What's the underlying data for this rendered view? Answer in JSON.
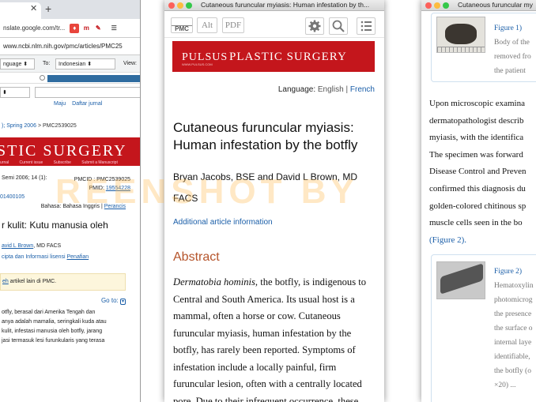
{
  "left_window": {
    "new_tab": "+",
    "translate_url": "nslate.google.com/tr...",
    "pmc_url": "www.ncbi.nlm.nih.gov/pmc/articles/PMC25",
    "from_lang": "nguage",
    "to_label": "To:",
    "to_lang": "Indonesian",
    "view_label": "View:",
    "links": [
      "Maju",
      "Daftar jurnal"
    ],
    "breadcrumb_1": "); Spring 2006",
    "breadcrumb_2": "PMC2539025",
    "banner_title": "STIC SURGERY",
    "banner_nav": [
      "urnal",
      "Current issue",
      "Subscribe",
      "Submit a Manuscript"
    ],
    "issue": "Semi 2006; 14 (1):",
    "pmcid": "PMCID : PMC2539025",
    "pmid_label": "PMID:",
    "pmid": "19554228",
    "doi": "01400105",
    "lang_label": "Bahasa: Bahasa",
    "lang_en": "Inggris",
    "lang_fr": "Perancis",
    "title": "r kulit: Kutu manusia oleh",
    "author_link": "avid L Brown",
    "author_suffix": ", MD FACS",
    "copyright": "cipta dan Informasi lisensi",
    "disclaimer": "Penafian",
    "notice_link": "eh",
    "notice_text": "artikel lain di PMC.",
    "goto": "Go to:",
    "abstract_lines": [
      "otfly, berasal dari Amerika Tengah dan",
      "anya adalah mamalia, seringkali kuda atau",
      "kulit, infestasi manusia oleh botfly, jarang",
      "jasi termasuk lesi furunkularis yang terasa"
    ]
  },
  "middle_window": {
    "window_title": "Cutaneous furuncular myiasis: Human infestation by th...",
    "toolbar": {
      "pmc": "PMC",
      "alt": "Alt",
      "pdf": "PDF"
    },
    "logo_pulsus": "PULSUS",
    "logo_pulsus_small": "WWW.PULSUS.COM",
    "logo_title": "PLASTIC SURGERY",
    "language_label": "Language:",
    "language_english": "English",
    "language_sep": "|",
    "language_french": "French",
    "article_title": "Cutaneous furuncular myiasis: Human infestation by the botfly",
    "authors": "Bryan Jacobs, BSE and David L Brown, MD FACS",
    "additional_info": "Additional article information",
    "abstract_heading": "Abstract",
    "abstract_species": "Dermatobia hominis",
    "abstract_text": ", the botfly, is indigenous to Central and South America. Its usual host is a mammal, often a horse or cow. Cutaneous furuncular myiasis, human infestation by the botfly, has rarely been reported. Symptoms of infestation include a locally painful, firm furuncular lesion, often with a centrally located pore. Due to their infrequent occurrence, these"
  },
  "right_window": {
    "window_title": "Cutaneous furuncular my",
    "figure1_link": "Figure 1)",
    "figure1_caption": [
      "Body of the",
      "removed fro",
      "the patient"
    ],
    "body_lines": [
      "Upon microscopic examina",
      "dermatopathologist describ",
      "myiasis, with the identifica",
      "The specimen was forward",
      "Disease Control and Preven",
      "confirmed this diagnosis du",
      "golden-colored chitinous sp",
      "muscle cells seen in the bo"
    ],
    "figure2_ref": "(Figure 2).",
    "figure2_link": "Figure 2)",
    "figure2_caption": [
      "Hematoxylin",
      "photomicrog",
      "the presence",
      "the surface o",
      "internal laye",
      "identifiable,",
      "the botfly (o",
      "×20) ..."
    ]
  },
  "watermark": "REENSHOT BY",
  "colors": {
    "pmc_red": "#c4161c",
    "link_blue": "#1a5ea8",
    "abstract_orange": "#b5542b"
  }
}
